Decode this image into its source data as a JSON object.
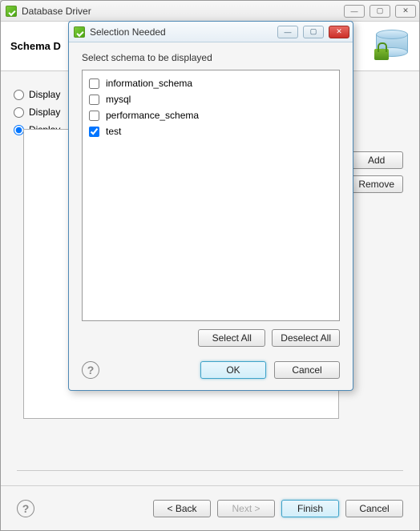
{
  "parent": {
    "title": "Database Driver",
    "banner_title": "Schema D",
    "radio_options": [
      "Display",
      "Display",
      "Display"
    ],
    "selected_radio": 2,
    "side_buttons": {
      "add": "Add",
      "remove": "Remove"
    },
    "wizard": {
      "back": "< Back",
      "next": "Next >",
      "finish": "Finish",
      "cancel": "Cancel"
    }
  },
  "modal": {
    "title": "Selection Needed",
    "instruction": "Select schema to be displayed",
    "schemas": [
      {
        "label": "information_schema",
        "checked": false
      },
      {
        "label": "mysql",
        "checked": false
      },
      {
        "label": "performance_schema",
        "checked": false
      },
      {
        "label": "test",
        "checked": true
      }
    ],
    "select_all": "Select All",
    "deselect_all": "Deselect All",
    "ok": "OK",
    "cancel": "Cancel"
  }
}
